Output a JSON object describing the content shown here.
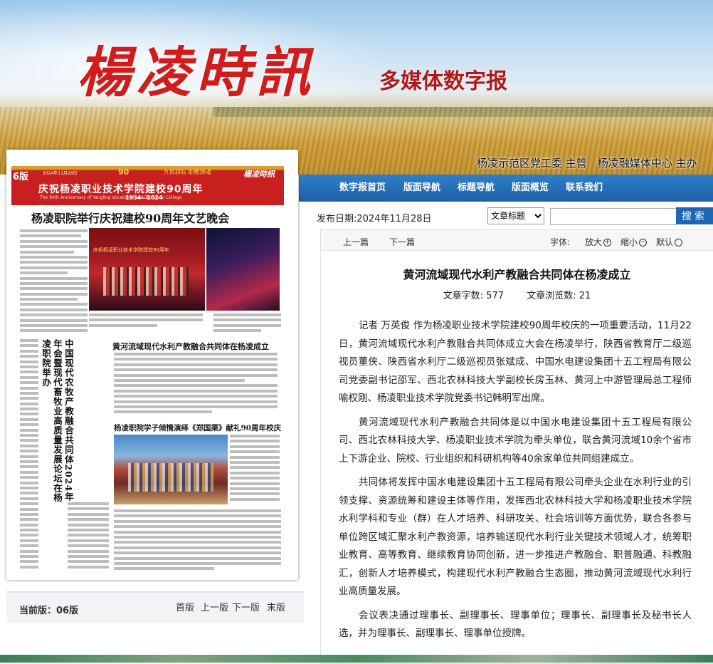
{
  "header": {
    "masthead": "楊凌時訊",
    "subtitle": "多媒体数字报",
    "org_line": "杨凌示范区党工委 主管　杨凌融媒体中心 主办"
  },
  "nav": {
    "items": [
      "数字报首页",
      "版面导航",
      "标题导航",
      "版面概览",
      "联系我们"
    ]
  },
  "paper": {
    "page_num": "6版",
    "date": "2024年11月28日",
    "anniv_badge": "90",
    "anniv_slogan": "九秩耕耘 职教铸魂",
    "logo": "楊凌時訊",
    "banner_title": "庆祝杨凌职业技术学院建校90周年",
    "banner_en": "The 90th Anniversary of Yangling Vocational and Technical College",
    "banner_years": "1934—2024",
    "headline_main": "杨凌职院举行庆祝建校90周年文艺晚会",
    "photo1_text": "庆祝杨凌职业技术学院建校90周年",
    "headline_2": "黄河流域现代水利产教融合共同体在杨凌成立",
    "headline_3": "杨凌职院学子倾情演绎《郑国渠》献礼90周年校庆",
    "vertical_title": "中国现代农牧产教融合共同体2024年年会暨现代畜牧业高质量发展论坛在杨凌职院举办"
  },
  "pager": {
    "current_edition": "当前版：06版",
    "links": [
      "首版",
      "上一版",
      "下一版",
      "末版"
    ]
  },
  "article": {
    "pubdate": "发布日期:2024年11月28日",
    "search_type": "文章标题",
    "search_placeholder": "",
    "search_button": "搜索",
    "prev": "上一篇",
    "next": "下一篇",
    "font_label": "字体:",
    "zoom_in": "放大",
    "zoom_out": "缩小",
    "default": "默认",
    "title": "黄河流域现代水利产教融合共同体在杨凌成立",
    "word_count_label": "文章字数: 577",
    "views_label": "文章浏览数: 21",
    "paragraphs": [
      "记者 万英俊 作为杨凌职业技术学院建校90周年校庆的一项重要活动，11月22日，黄河流域现代水利产教融合共同体成立大会在杨凌举行，陕西省教育厅二级巡视员董侠、陕西省水利厅二级巡视员张斌成、中国水电建设集团十五工程局有限公司党委副书记邵军、西北农林科技大学副校长房玉林、黄河上中游管理局总工程师喻权刚、杨凌职业技术学院党委书记韩明军出席。",
      "黄河流域现代水利产教融合共同体是以中国水电建设集团十五工程局有限公司、西北农林科技大学、杨凌职业技术学院为牵头单位，联合黄河流域10余个省市上下游企业、院校、行业组织和科研机构等40余家单位共同组建成立。",
      "共同体将发挥中国水电建设集团十五工程局有限公司牵头企业在水利行业的引领支撑、资源统筹和建设主体等作用，发挥西北农林科技大学和杨凌职业技术学院水利学科和专业（群）在人才培养、科研攻关、社会培训等方面优势，联合各参与单位跨区域汇聚水利产教资源，培养输送现代水利行业关键技术领域人才，统筹职业教育、高等教育、继续教育协同创新，进一步推进产教融合、职普融通、科教融汇，创新人才培养模式，构建现代水利产教融合生态圈，推动黄河流域现代水利行业高质量发展。",
      "会议表决通过理事长、副理事长、理事单位；理事长、副理事长及秘书长人选，并为理事长、副理事长、理事单位授牌。"
    ]
  }
}
